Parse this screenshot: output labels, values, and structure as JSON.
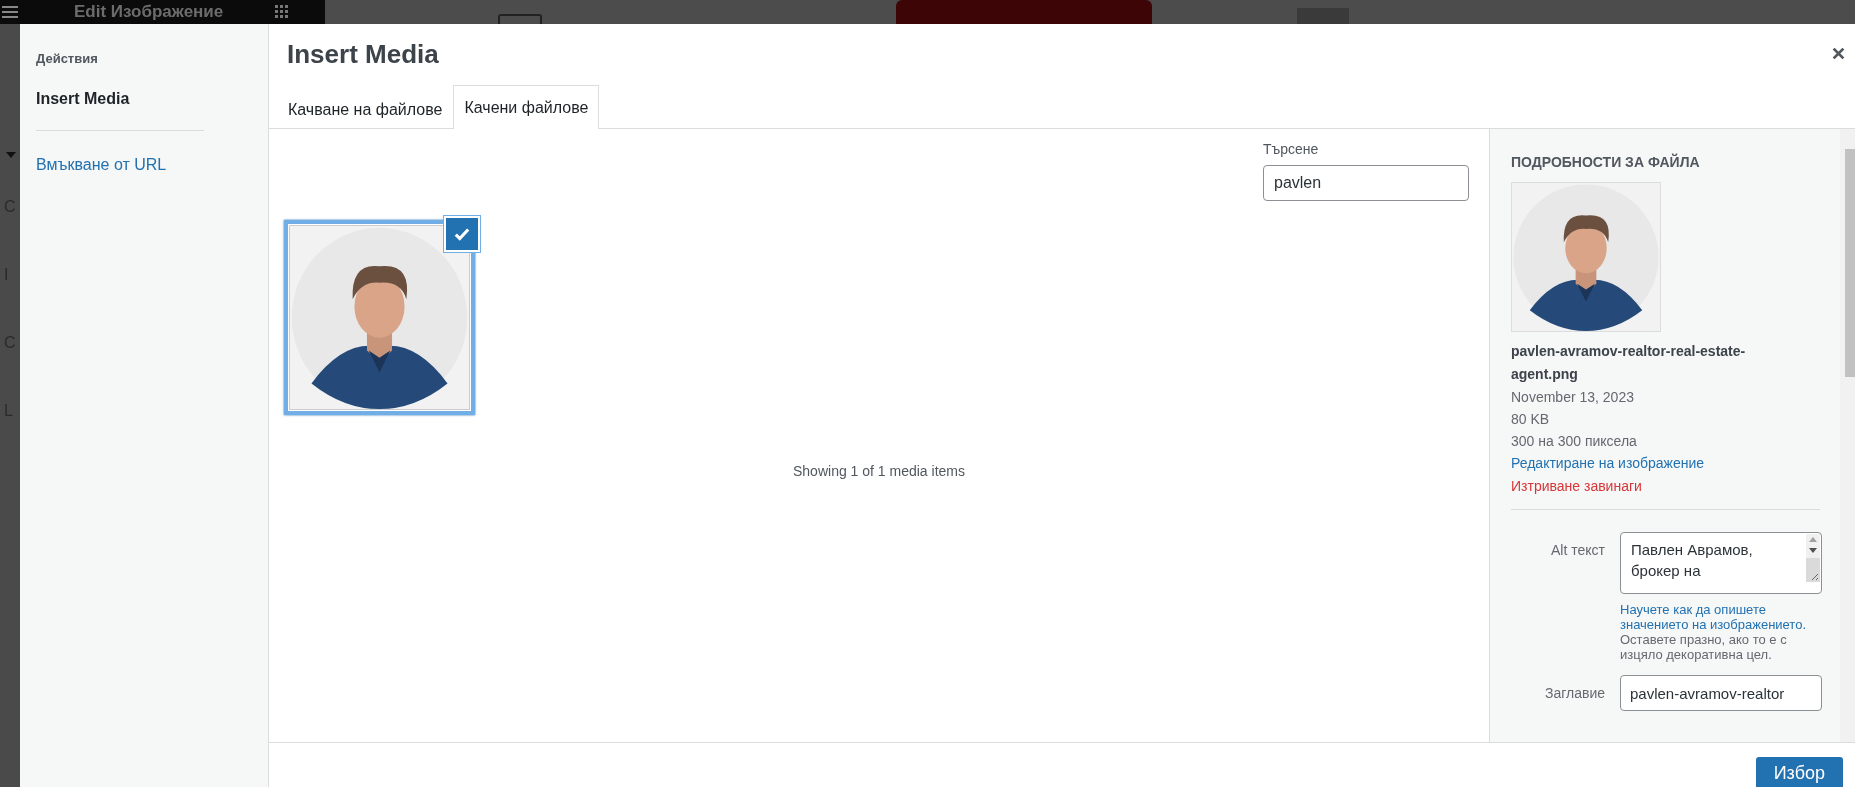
{
  "background": {
    "title": "Edit Изображение",
    "side_letters": [
      "C",
      "I",
      "C",
      "L"
    ]
  },
  "sidebar": {
    "heading": "Действия",
    "items": [
      {
        "label": "Insert Media",
        "kind": "menu",
        "selected": true
      },
      {
        "label": "Вмъкване от URL",
        "kind": "link",
        "selected": false
      }
    ]
  },
  "title": "Insert Media",
  "tabs": [
    {
      "label": "Качване на файлове",
      "selected": false
    },
    {
      "label": "Качени файлове",
      "selected": true
    }
  ],
  "search": {
    "label": "Търсене",
    "value": "pavlen"
  },
  "attachments": [
    {
      "kind": "picture",
      "selected": true
    }
  ],
  "status": "Showing 1 of 1 media items",
  "details": {
    "heading": "ПОДРОБНОСТИ ЗА ФАЙЛА",
    "filename": "pavlen-avramov-realtor-real-estate-agent.png",
    "meta": [
      "November 13, 2023",
      "80 KB",
      "300 на 300 пиксела"
    ],
    "actions": [
      {
        "label": "Редактиране на изображение",
        "kind": "edit"
      },
      {
        "label": "Изтриване завинаги",
        "kind": "delete"
      }
    ],
    "fields": [
      {
        "label": "Alt текст",
        "kind": "textarea",
        "value": "Павлен Аврамов, брокер на",
        "help_link": "Научете как да опишете значението на изображението.",
        "help": "Оставете празно, ако то е с изцяло декоративна цел."
      },
      {
        "label": "Заглавие",
        "kind": "input",
        "value": "pavlen-avramov-realtor"
      }
    ]
  },
  "button": "Избор"
}
